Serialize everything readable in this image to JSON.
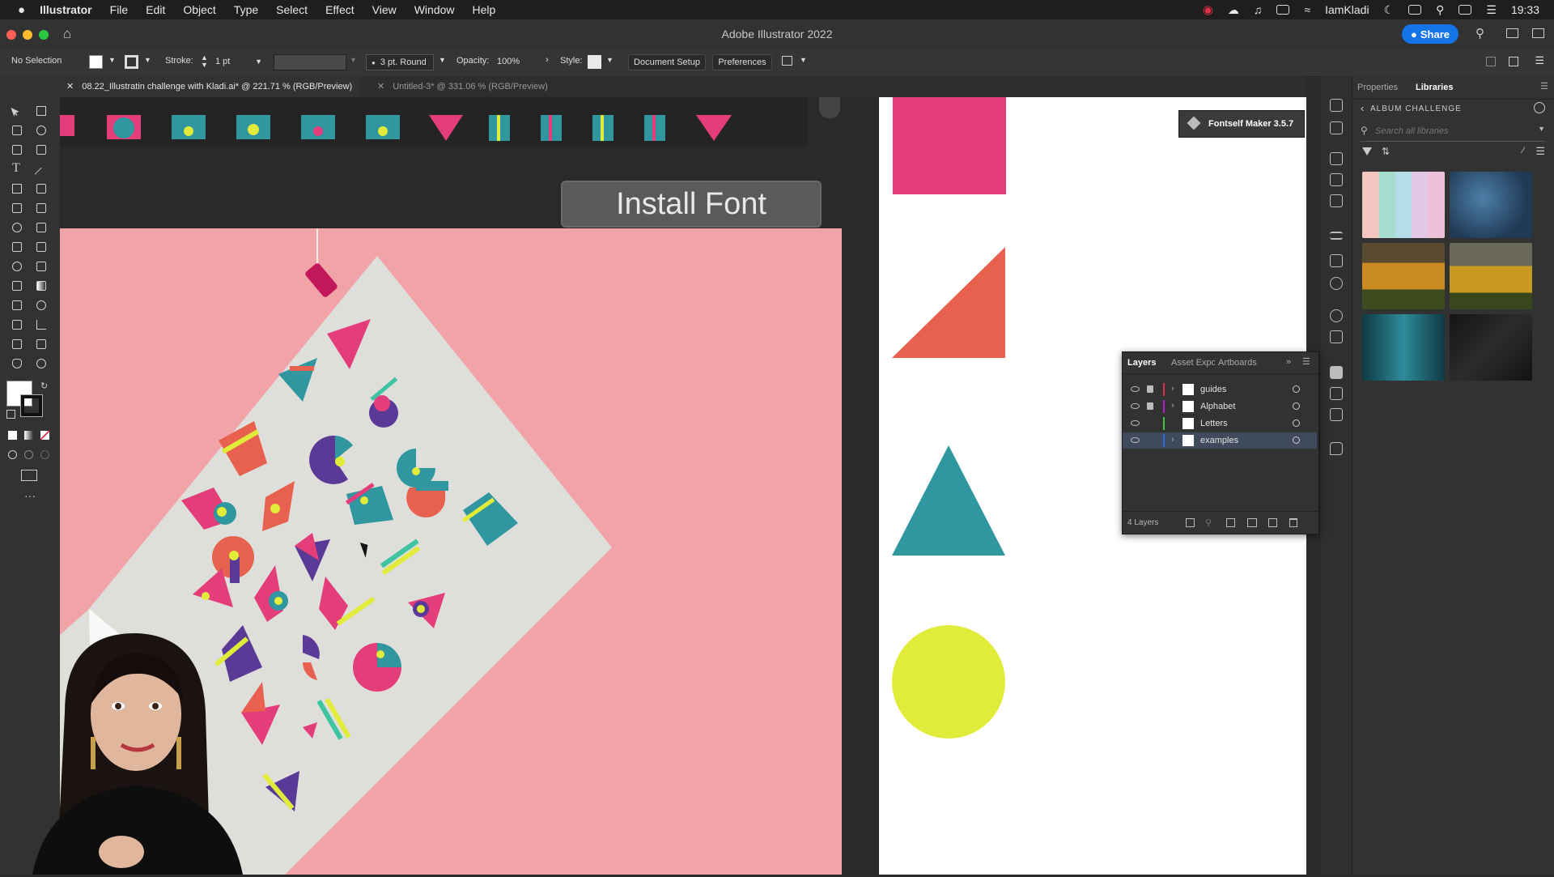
{
  "menubar": {
    "app": "Illustrator",
    "items": [
      "File",
      "Edit",
      "Object",
      "Type",
      "Select",
      "Effect",
      "View",
      "Window",
      "Help"
    ],
    "user": "IamKladi",
    "time": "19:33"
  },
  "window": {
    "title": "Adobe Illustrator 2022",
    "share_label": "Share"
  },
  "control_bar": {
    "selection": "No Selection",
    "stroke_label": "Stroke:",
    "stroke_value": "1 pt",
    "brush_value": "3 pt. Round",
    "opacity_label": "Opacity:",
    "opacity_value": "100%",
    "style_label": "Style:",
    "document_setup": "Document Setup",
    "preferences": "Preferences"
  },
  "tabs": [
    {
      "label": "08.22_Illustratin challenge with Kladi.ai* @ 221.71 % (RGB/Preview)",
      "active": true
    },
    {
      "label": "Untitled-3* @ 331.06 % (RGB/Preview)",
      "active": false
    }
  ],
  "canvas": {
    "overlay_text": "Install Font"
  },
  "right_panel": {
    "tabs": [
      "Properties",
      "Libraries"
    ],
    "active_tab": "Libraries",
    "library_name": "ALBUM CHALLENGE",
    "search_placeholder": "Search all libraries"
  },
  "fontself": {
    "label": "Fontself Maker 3.5.7"
  },
  "layers_panel": {
    "tabs": [
      "Layers",
      "Asset Expo",
      "Artboards"
    ],
    "layers": [
      {
        "name": "guides",
        "color": "#e0304a",
        "locked": true
      },
      {
        "name": "Alphabet",
        "color": "#b01ecb",
        "locked": true
      },
      {
        "name": "Letters",
        "color": "#3ec43e",
        "locked": false
      },
      {
        "name": "examples",
        "color": "#2f66e6",
        "locked": false
      }
    ],
    "count": "4 Layers"
  },
  "colors": {
    "accent": "#1473e6",
    "pink_bg": "#f2a3a7",
    "magenta": "#e33d7a",
    "coral": "#e8614e",
    "teal": "#3096a0",
    "yellow": "#e1ec3a",
    "purple": "#5a3a96"
  }
}
